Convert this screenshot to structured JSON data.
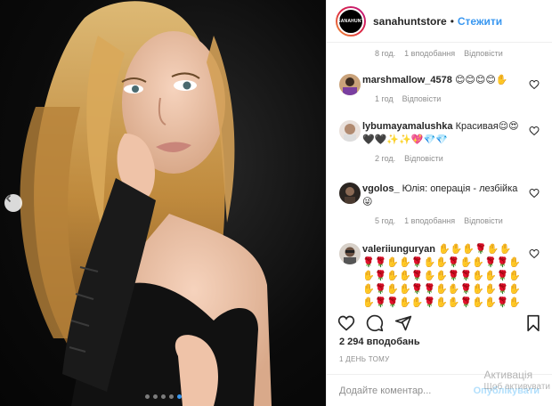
{
  "header": {
    "avatar_text": "SANAHUNT",
    "username": "sanahuntstore",
    "separator": "•",
    "follow_label": "Стежити"
  },
  "top_partial": {
    "time": "8 год.",
    "likes": "1 вподобання",
    "reply": "Відповісти"
  },
  "comments": [
    {
      "username": "marshmallow_4578",
      "text": "😊😊😊😊✋",
      "time": "1 год",
      "reply": "Відповісти"
    },
    {
      "username": "lybumayamalushka",
      "text": "Красивая😌😍🖤🖤✨✨💖💎💎",
      "time": "2 год.",
      "reply": "Відповісти"
    },
    {
      "username": "vgolos_",
      "text": "Юлія: операція - лезбійка😜",
      "time": "5 год.",
      "likes": "1 вподобання",
      "reply": "Відповісти"
    },
    {
      "username": "valeriiunguryan",
      "text": "✋✋✋🌹✋✋🌹🌹✋✋🌹✋✋🌹✋✋🌹🌹✋✋🌹✋✋🌹✋✋🌹🌹✋✋🌹✋✋🌹✋✋🌹🌹✋✋🌹✋✋🌹✋✋🌹🌹✋✋🌹✋✋🌹✋✋🌹✋✋"
    }
  ],
  "footer": {
    "likes": "2 294 вподобань",
    "time": "1 ДЕНЬ ТОМУ",
    "comment_placeholder": "Додайте коментар...",
    "publish_label": "Опублікувати"
  },
  "watermark": {
    "line1": "Активація",
    "line2": "Щоб активувати"
  },
  "colors": {
    "accent": "#3897f0",
    "muted": "#8e8e8e",
    "text": "#262626",
    "publish_disabled": "#b2dffc"
  },
  "carousel": {
    "total": 5,
    "active_index": 4
  }
}
